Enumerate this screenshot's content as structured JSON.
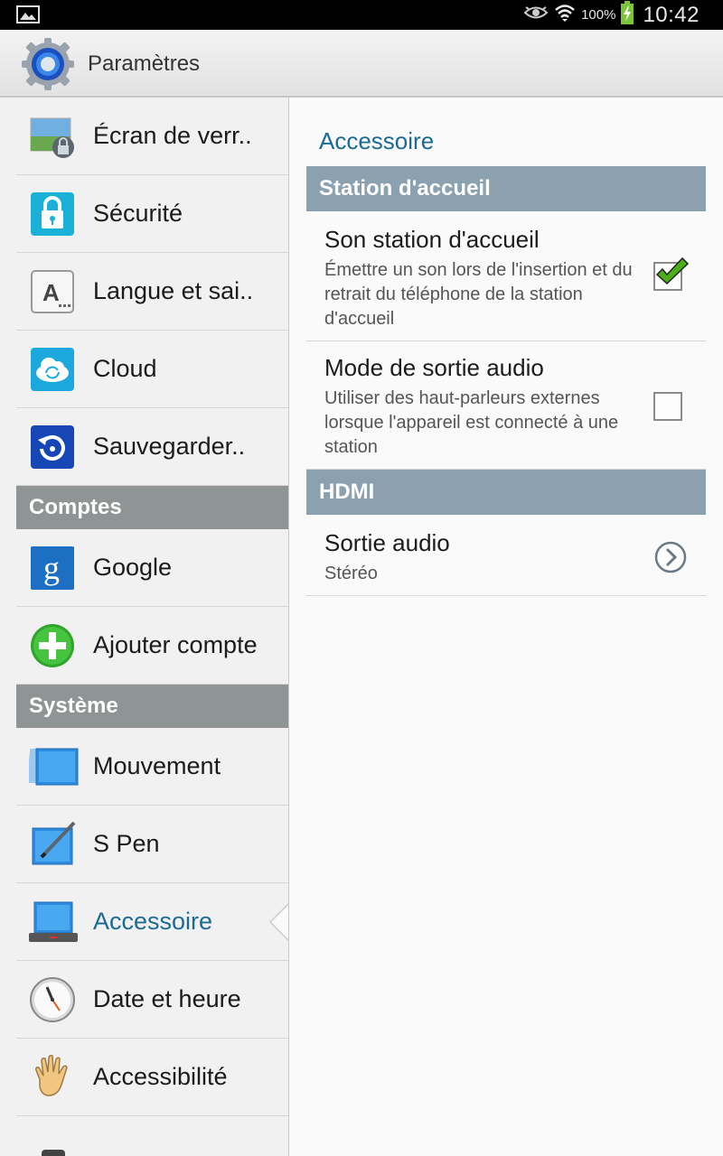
{
  "status_bar": {
    "battery_percent": "100%",
    "time": "10:42",
    "icons": [
      "gallery-notification-icon",
      "eye-icon",
      "wifi-icon",
      "battery-charging-icon"
    ]
  },
  "app_bar": {
    "title": "Paramètres",
    "icon": "settings-gear-icon"
  },
  "left_pane": {
    "items_top": [
      {
        "label": "Écran de verr..",
        "icon": "lockscreen-icon"
      },
      {
        "label": "Sécurité",
        "icon": "security-lock-icon"
      },
      {
        "label": "Langue et sai..",
        "icon": "language-keyboard-icon"
      },
      {
        "label": "Cloud",
        "icon": "cloud-icon"
      },
      {
        "label": "Sauvegarder..",
        "icon": "backup-icon"
      }
    ],
    "header_accounts": "Comptes",
    "items_accounts": [
      {
        "label": "Google",
        "icon": "google-icon"
      },
      {
        "label": "Ajouter compte",
        "icon": "add-account-icon"
      }
    ],
    "header_system": "Système",
    "items_system": [
      {
        "label": "Mouvement",
        "icon": "motion-icon"
      },
      {
        "label": "S Pen",
        "icon": "s-pen-icon"
      },
      {
        "label": "Accessoire",
        "icon": "accessory-icon",
        "selected": true
      },
      {
        "label": "Date et heure",
        "icon": "clock-icon"
      },
      {
        "label": "Accessibilité",
        "icon": "accessibility-hand-icon"
      }
    ]
  },
  "right_pane": {
    "title": "Accessoire",
    "section_dock": "Station d'accueil",
    "dock_sound": {
      "title": "Son station d'accueil",
      "summary": "Émettre un son lors de l'insertion et du retrait du téléphone de la station d'accueil",
      "checked": true
    },
    "audio_output_mode": {
      "title": "Mode de sortie audio",
      "summary": "Utiliser des haut-parleurs externes lorsque l'appareil est connecté à une station",
      "checked": false
    },
    "section_hdmi": "HDMI",
    "audio_output": {
      "title": "Sortie audio",
      "summary": "Stéréo"
    }
  },
  "colors": {
    "accent": "#1a6a96",
    "left_header": "#8f9495",
    "right_header": "#8ba1b0",
    "check_green": "#4caf1a"
  }
}
